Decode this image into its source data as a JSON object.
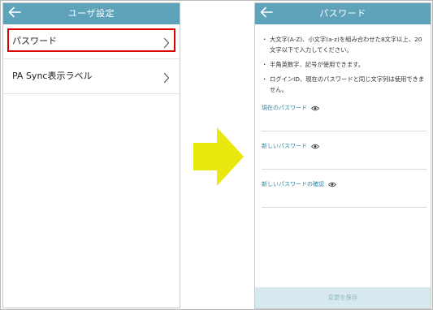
{
  "left_screen": {
    "header": {
      "back_icon": "arrow-left-icon",
      "title": "ユーザ設定"
    },
    "menu": [
      {
        "label": "パスワード",
        "icon": "chevron-right-icon",
        "highlighted": true
      },
      {
        "label": "PA Sync表示ラベル",
        "icon": "chevron-right-icon",
        "highlighted": false
      }
    ]
  },
  "transition_arrow": {
    "icon": "arrow-right-icon",
    "color": "#e8e80f"
  },
  "right_screen": {
    "header": {
      "back_icon": "arrow-left-icon",
      "title": "パスワード"
    },
    "rules": [
      {
        "bullet": "・",
        "text": "大文字(A-Z)、小文字(a-z)を組み合わせた8文字以上、20文字以下で入力してください。"
      },
      {
        "bullet": "・",
        "text": "半角英数字、記号が使用できます。"
      },
      {
        "bullet": "・",
        "text": "ログインID、現在のパスワードと同じ文字列は使用できません。"
      }
    ],
    "fields": [
      {
        "label": "現在のパスワード",
        "icon": "eye-icon",
        "value": ""
      },
      {
        "label": "新しいパスワード",
        "icon": "eye-icon",
        "value": ""
      },
      {
        "label": "新しいパスワードの確認",
        "icon": "eye-icon",
        "value": ""
      }
    ],
    "save_button": "変更を保存"
  },
  "colors": {
    "header": "#5ea3ba",
    "highlight": "#e00000",
    "field_label": "#2f86a6",
    "save_button_bg": "#d6e9ef",
    "save_button_text": "#8fb6c3",
    "arrow": "#e8e80f"
  }
}
